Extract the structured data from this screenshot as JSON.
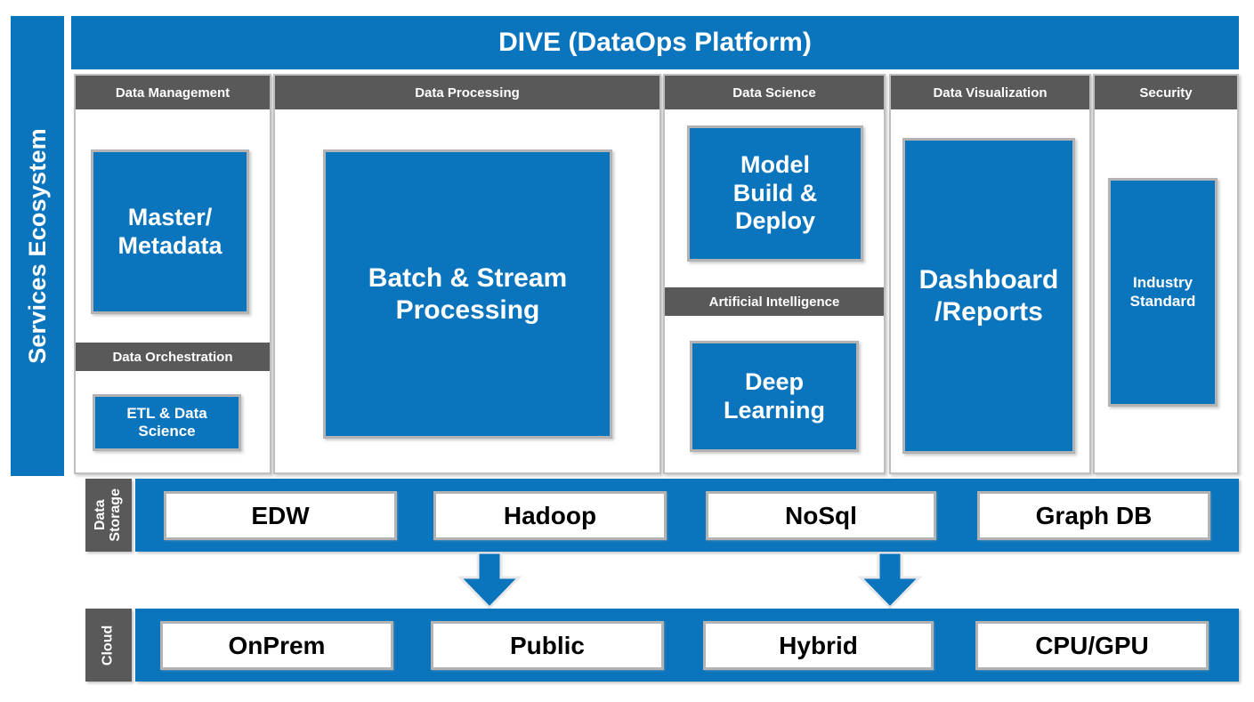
{
  "sidebar": {
    "label": "Services Ecosystem"
  },
  "header": {
    "title": "DIVE (DataOps Platform)"
  },
  "columns": [
    {
      "id": "data-management",
      "header": "Data Management",
      "tiles": [
        "Master/\nMetadata"
      ],
      "sub_header": "Data Orchestration",
      "sub_tiles": [
        "ETL & Data\nScience"
      ]
    },
    {
      "id": "data-processing",
      "header": "Data Processing",
      "tiles": [
        "Batch & Stream\nProcessing"
      ]
    },
    {
      "id": "data-science",
      "header": "Data Science",
      "tiles": [
        "Model\nBuild &\nDeploy"
      ],
      "sub_header": "Artificial Intelligence",
      "sub_tiles": [
        "Deep\nLearning"
      ]
    },
    {
      "id": "data-visualization",
      "header": "Data Visualization",
      "tiles": [
        "Dashboard\n/Reports"
      ]
    },
    {
      "id": "security",
      "header": "Security",
      "tiles": [
        "Industry\nStandard"
      ]
    }
  ],
  "tile_text": {
    "master_metadata_line1": "Master/",
    "master_metadata_line2": "Metadata",
    "etl_line1": "ETL & Data",
    "etl_line2": "Science",
    "batch_line1": "Batch & Stream",
    "batch_line2": "Processing",
    "model_line1": "Model",
    "model_line2": "Build &",
    "model_line3": "Deploy",
    "deep_line1": "Deep",
    "deep_line2": "Learning",
    "dashboard_line1": "Dashboard",
    "dashboard_line2": "/Reports",
    "industry_line1": "Industry",
    "industry_line2": "Standard"
  },
  "sub_headers": {
    "data_orchestration": "Data Orchestration",
    "artificial_intelligence": "Artificial Intelligence"
  },
  "storage": {
    "label_line1": "Data",
    "label_line2": "Storage",
    "items": [
      "EDW",
      "Hadoop",
      "NoSql",
      "Graph DB"
    ]
  },
  "cloud": {
    "label": "Cloud",
    "items": [
      "OnPrem",
      "Public",
      "Hybrid",
      "CPU/GPU"
    ]
  },
  "arrows": [
    {
      "name": "arrow-storage-to-cloud-left"
    },
    {
      "name": "arrow-storage-to-cloud-right"
    }
  ],
  "colors": {
    "brand_blue": "#0a74bd",
    "header_gray": "#595959",
    "border_gray": "#b3b3b3",
    "white": "#ffffff",
    "text_black": "#000000"
  }
}
